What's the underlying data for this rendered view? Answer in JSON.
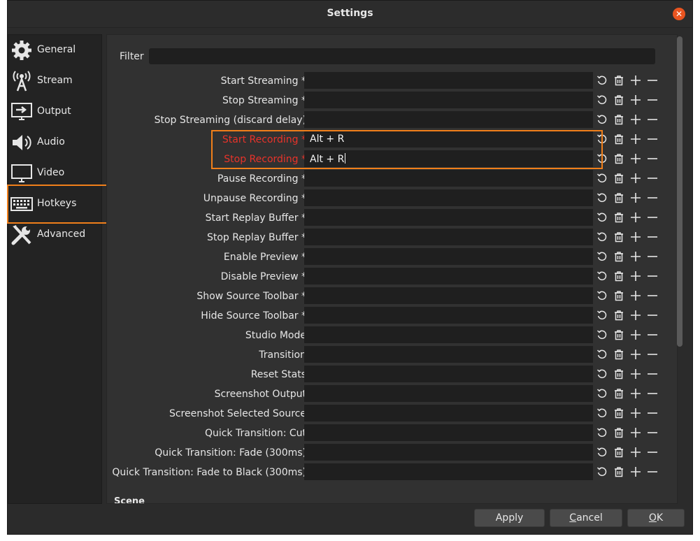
{
  "window": {
    "title": "Settings"
  },
  "sidebar": {
    "items": [
      {
        "label": "General",
        "icon": "gear-icon"
      },
      {
        "label": "Stream",
        "icon": "broadcast-icon"
      },
      {
        "label": "Output",
        "icon": "output-monitor-icon"
      },
      {
        "label": "Audio",
        "icon": "speaker-icon"
      },
      {
        "label": "Video",
        "icon": "monitor-icon"
      },
      {
        "label": "Hotkeys",
        "icon": "keyboard-icon",
        "selected": true
      },
      {
        "label": "Advanced",
        "icon": "tools-icon"
      }
    ]
  },
  "hotkeys": {
    "filter_label": "Filter",
    "filter_value": "",
    "rows": [
      {
        "label": "Start Streaming *",
        "value": ""
      },
      {
        "label": "Stop Streaming *",
        "value": ""
      },
      {
        "label": "Stop Streaming (discard delay)",
        "value": ""
      },
      {
        "label": "Start Recording *",
        "value": "Alt + R",
        "conflict": true
      },
      {
        "label": "Stop Recording *",
        "value": "Alt + R",
        "conflict": true
      },
      {
        "label": "Pause Recording *",
        "value": ""
      },
      {
        "label": "Unpause Recording *",
        "value": ""
      },
      {
        "label": "Start Replay Buffer *",
        "value": ""
      },
      {
        "label": "Stop Replay Buffer *",
        "value": ""
      },
      {
        "label": "Enable Preview *",
        "value": ""
      },
      {
        "label": "Disable Preview *",
        "value": ""
      },
      {
        "label": "Show Source Toolbar *",
        "value": ""
      },
      {
        "label": "Hide Source Toolbar *",
        "value": ""
      },
      {
        "label": "Studio Mode",
        "value": ""
      },
      {
        "label": "Transition",
        "value": ""
      },
      {
        "label": "Reset Stats",
        "value": ""
      },
      {
        "label": "Screenshot Output",
        "value": ""
      },
      {
        "label": "Screenshot Selected Source",
        "value": ""
      },
      {
        "label": "Quick Transition: Cut",
        "value": ""
      },
      {
        "label": "Quick Transition: Fade (300ms)",
        "value": ""
      },
      {
        "label": "Quick Transition: Fade to Black (300ms)",
        "value": ""
      }
    ],
    "section_header": "Scene"
  },
  "buttons": {
    "apply": "Apply",
    "cancel_first": "C",
    "cancel_rest": "ancel",
    "ok_first": "O",
    "ok_rest": "K"
  },
  "colors": {
    "accent_highlight": "#f07f1a",
    "conflict_text": "#e8332a",
    "close_button": "#e95420"
  }
}
